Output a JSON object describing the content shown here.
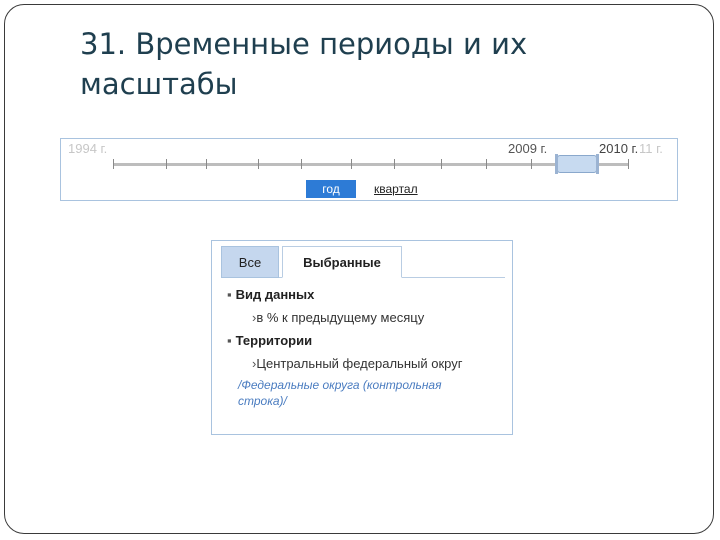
{
  "slide": {
    "title_line1": "31. Временные периоды и их",
    "title_line2": "масштабы"
  },
  "timeline": {
    "start_label": "1994 г.",
    "label_2009": "2009 г.",
    "label_2010": "2010 г.",
    "end_label": "11 г.",
    "btn_year": "год",
    "btn_quarter": "квартал"
  },
  "panel": {
    "tab_all": "Все",
    "tab_selected": "Выбранные",
    "section1": {
      "title": "Вид данных",
      "item": "в % к предыдущему месяцу"
    },
    "section2": {
      "title": "Территории",
      "item": "Центральный федеральный округ"
    },
    "note": "/Федеральные округа (контрольная строка)/",
    "bullet": "▪",
    "arrow": "›"
  },
  "colors": {
    "title": "#1f3f4f",
    "accent": "#2d7bd6",
    "panel_border": "#a9c3df",
    "note": "#4a7cc0"
  }
}
